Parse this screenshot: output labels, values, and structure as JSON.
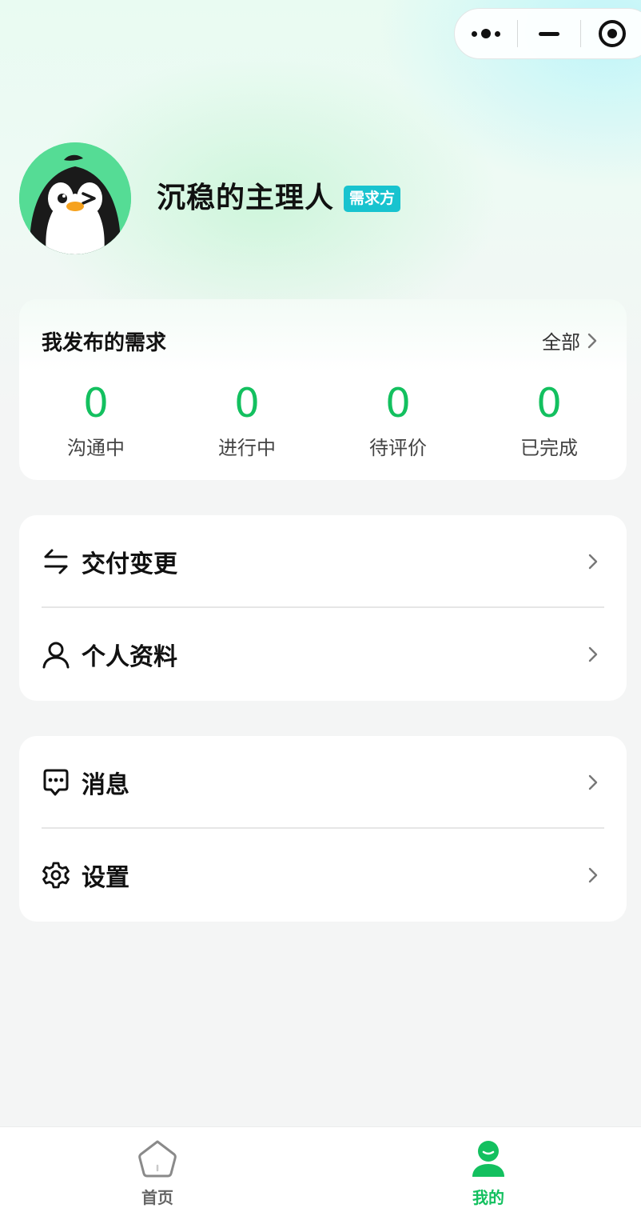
{
  "capsule": {
    "more_icon": "more-dots-icon",
    "minimize_icon": "minimize-icon",
    "close_icon": "target-close-icon"
  },
  "profile": {
    "name": "沉稳的主理人",
    "role": "需求方",
    "avatar": "penguin-avatar"
  },
  "demands": {
    "title": "我发布的需求",
    "all_label": "全部",
    "stats": [
      {
        "value": "0",
        "label": "沟通中"
      },
      {
        "value": "0",
        "label": "进行中"
      },
      {
        "value": "0",
        "label": "待评价"
      },
      {
        "value": "0",
        "label": "已完成"
      }
    ]
  },
  "menu": {
    "items": [
      {
        "label": "交付变更",
        "icon": "swap-arrows-icon"
      },
      {
        "label": "个人资料",
        "icon": "user-icon"
      },
      {
        "label": "消息",
        "icon": "message-icon"
      },
      {
        "label": "设置",
        "icon": "gear-icon"
      }
    ]
  },
  "tabbar": {
    "tabs": [
      {
        "label": "首页",
        "icon": "home-icon",
        "active": false
      },
      {
        "label": "我的",
        "icon": "profile-icon",
        "active": true
      }
    ]
  },
  "colors": {
    "accent": "#13c05f",
    "badge": "#18c3cf",
    "inactive_tab": "#666666"
  }
}
